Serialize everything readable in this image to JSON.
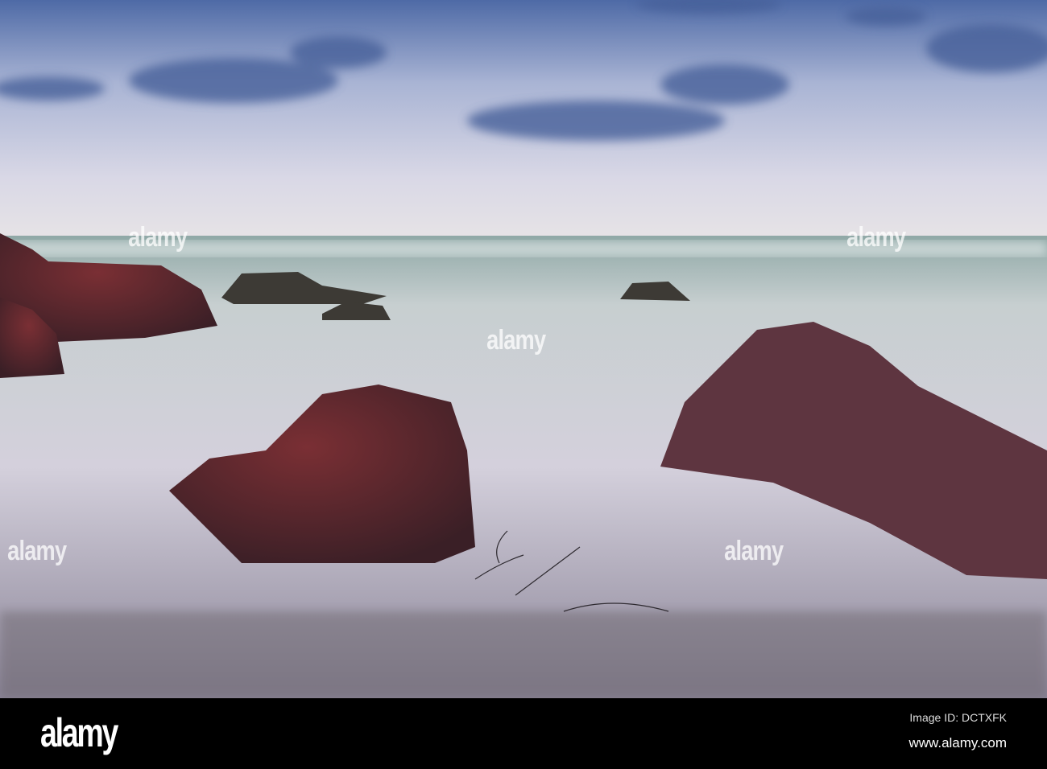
{
  "watermark": "alamy",
  "footer": {
    "logo": "alamy",
    "image_id": "Image ID: DCTXFK",
    "url": "www.alamy.com"
  }
}
